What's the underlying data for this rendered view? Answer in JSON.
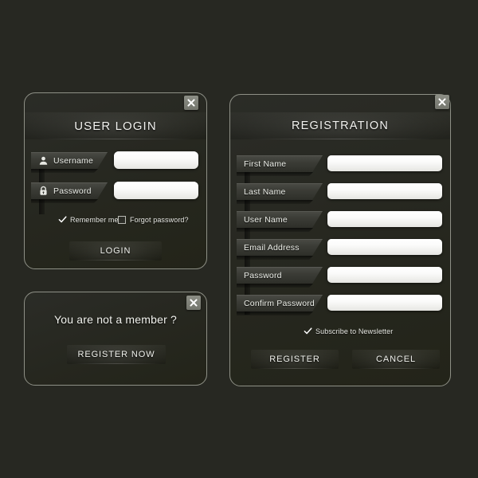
{
  "theme": {
    "background": "#272822",
    "panel_border": "#8e9086",
    "tag_text": "#eceee8",
    "field_fill": "#ffffff",
    "accent_text": "#f2f2ef"
  },
  "login_panel": {
    "title": "USER LOGIN",
    "close_icon": "close-icon",
    "fields": [
      {
        "label": "Username",
        "icon": "user-icon",
        "value": "",
        "placeholder": ""
      },
      {
        "label": "Password",
        "icon": "lock-icon",
        "value": "",
        "placeholder": ""
      }
    ],
    "remember_me": {
      "label": "Remember me",
      "checked": true,
      "icon": "checkmark-icon"
    },
    "forgot_password": {
      "label": "Forgot password?",
      "checked": false,
      "icon": "empty-checkbox-icon"
    },
    "submit_label": "LOGIN"
  },
  "member_panel": {
    "close_icon": "close-icon",
    "question": "You are not a member ?",
    "register_label": "REGISTER NOW"
  },
  "registration_panel": {
    "title": "REGISTRATION",
    "close_icon": "close-icon",
    "fields": [
      {
        "label": "First Name",
        "value": "",
        "placeholder": ""
      },
      {
        "label": "Last Name",
        "value": "",
        "placeholder": ""
      },
      {
        "label": "User Name",
        "value": "",
        "placeholder": ""
      },
      {
        "label": "Email Address",
        "value": "",
        "placeholder": ""
      },
      {
        "label": "Password",
        "value": "",
        "placeholder": ""
      },
      {
        "label": "Confirm Password",
        "value": "",
        "placeholder": ""
      }
    ],
    "newsletter": {
      "label": "Subscribe to Newsletter",
      "checked": true,
      "icon": "checkmark-icon"
    },
    "register_label": "REGISTER",
    "cancel_label": "CANCEL"
  }
}
